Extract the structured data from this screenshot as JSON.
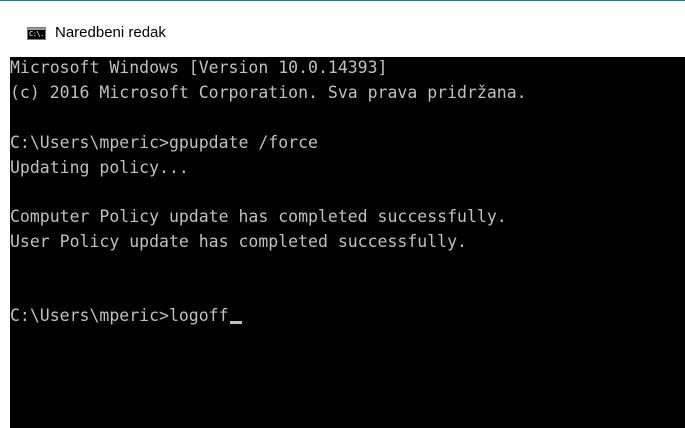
{
  "window": {
    "title": "Naredbeni redak",
    "icon": "console-icon",
    "icon_label": "C:\\."
  },
  "console": {
    "lines": [
      "Microsoft Windows [Version 10.0.14393]",
      "(c) 2016 Microsoft Corporation. Sva prava pridržana.",
      "",
      "C:\\Users\\mperic>gpupdate /force",
      "Updating policy...",
      "",
      "Computer Policy update has completed successfully.",
      "User Policy update has completed successfully.",
      "",
      "",
      "C:\\Users\\mperic>logoff"
    ],
    "text_color": "#c0c0c0",
    "background_color": "#000000"
  }
}
